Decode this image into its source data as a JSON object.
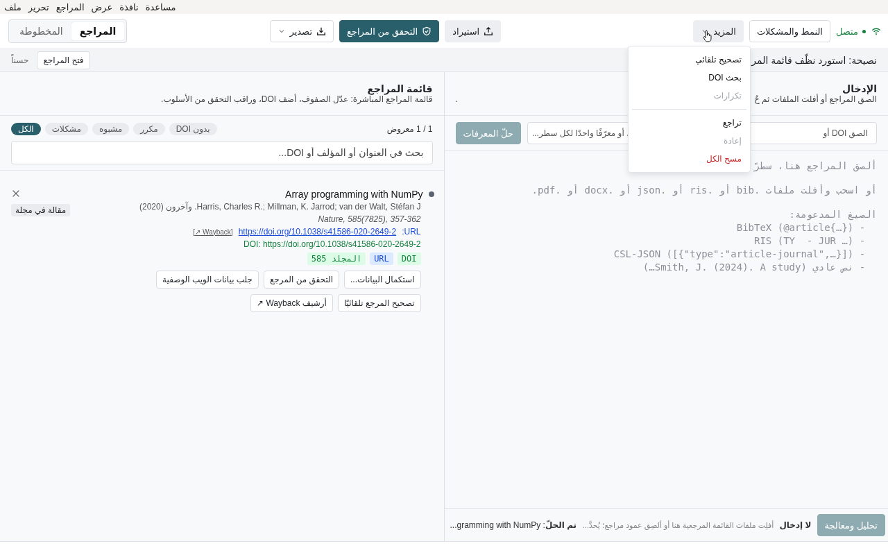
{
  "menu_bar": [
    "مساعدة",
    "نافذة",
    "عرض",
    "المراجع",
    "تحرير",
    "ملف"
  ],
  "toolbar": {
    "status": {
      "label": "متصل",
      "connected": true
    },
    "style_button": "النمط والمشكلات",
    "more_button": {
      "label": "المزيد",
      "expanded": true
    },
    "import_button": "استيراد",
    "verify_button": "التحقق من المراجع",
    "export_button": "تصدير",
    "tabs": [
      {
        "label": "المراجع",
        "selected": true
      },
      {
        "label": "المخطوطة",
        "selected": false
      }
    ]
  },
  "more_menu": [
    {
      "kind": "action",
      "label": "تصحيح تلقائي",
      "disabled": false
    },
    {
      "kind": "action",
      "label": "بحث DOI",
      "disabled": false
    },
    {
      "kind": "action",
      "label": "تكرارات",
      "disabled": true
    },
    {
      "kind": "separator"
    },
    {
      "kind": "action",
      "label": "تراجع",
      "disabled": false
    },
    {
      "kind": "action",
      "label": "إعادة",
      "disabled": true
    },
    {
      "kind": "danger",
      "label": "مسح الكل",
      "disabled": false
    }
  ],
  "tip": {
    "text": "نصيحة: استورد نظّف قائمة المر",
    "button": "فتح المراجع",
    "dismiss": "حسناً"
  },
  "input_panel": {
    "title": "الإدخال",
    "subtitle_parts": [
      "الصق المراجع أو أفلت الملفات ثم حٌ",
      "."
    ],
    "identifier_field": {
      "placeholder_parts": [
        "الصق DOI أو",
        "، أو معرّفًا واحدًا لكل سطر..."
      ]
    },
    "resolve_button": {
      "label": "حلّ المعرفات",
      "disabled": true
    },
    "textarea": {
      "placeholder_blocks": [
        [
          "ألصق المراجع هنا، سطرً"
        ],
        [
          "أو اسحب وأفلت ملفات .bib أو .ris أو .json أو .docx أو .pdf."
        ],
        [
          "الصيغ المدعومة:",
          "  - BibTeX (@article{…})",
          "  - RIS (TY  - JUR …)",
          "  - CSL-JSON ([{\"type\":\"article-journal\",…}])",
          "  - نص عادي (Smith, J. (2024). A study…)"
        ]
      ]
    },
    "footer": {
      "parse_button": {
        "label": "تحليل ومعالجة",
        "disabled": true
      },
      "input_state": "لا إدخال",
      "hint": "أفلِت ملفات القائمة المرجعية هنا أو ألصِق عمود مراجع؛ يُحدَّ...",
      "status": "**تم الحلّ**: gramming with NumPy..."
    }
  },
  "references_panel": {
    "title": "قائمة المراجع",
    "subtitle": "قائمة المراجع المباشرة: عدّل الصفوف، أضف DOI، وراقب التحقق من الأسلوب.",
    "count": "1 / 1 معروض",
    "filters": [
      {
        "label": "بدون DOI",
        "selected": false
      },
      {
        "label": "مكرر",
        "selected": false
      },
      {
        "label": "مشبوه",
        "selected": false
      },
      {
        "label": "مشكلات",
        "selected": false
      },
      {
        "label": "الكل",
        "selected": true
      }
    ],
    "search": {
      "placeholder": "بحث في العنوان أو المؤلف أو DOI..."
    },
    "references": [
      {
        "title": "Array programming with NumPy",
        "authors": "Harris, Charles R.; Millman, K. Jarrod; van der Walt, Stéfan J. وآخرون (2020)",
        "journal": "Nature, 585(7825), 357-362",
        "url_label": "URL:",
        "url": "https://doi.org/10.1038/s41586-020-2649-2",
        "wayback": "[↗ Wayback]",
        "doi": "DOI: https://doi.org/10.1038/s41586-020-2649-2",
        "badges": [
          {
            "label": "DOI",
            "kind": "ok"
          },
          {
            "label": "URL",
            "kind": "info"
          },
          {
            "label": "المجلد 585",
            "kind": "ok"
          }
        ],
        "actions": [
          [
            "استكمال البيانات...",
            "التحقق من المرجع",
            "جلب بيانات الويب الوصفية"
          ],
          [
            "تصحيح المرجع تلقائيًا",
            "أرشيف Wayback ↗"
          ]
        ],
        "type": "مقالة في مجلة"
      }
    ]
  }
}
